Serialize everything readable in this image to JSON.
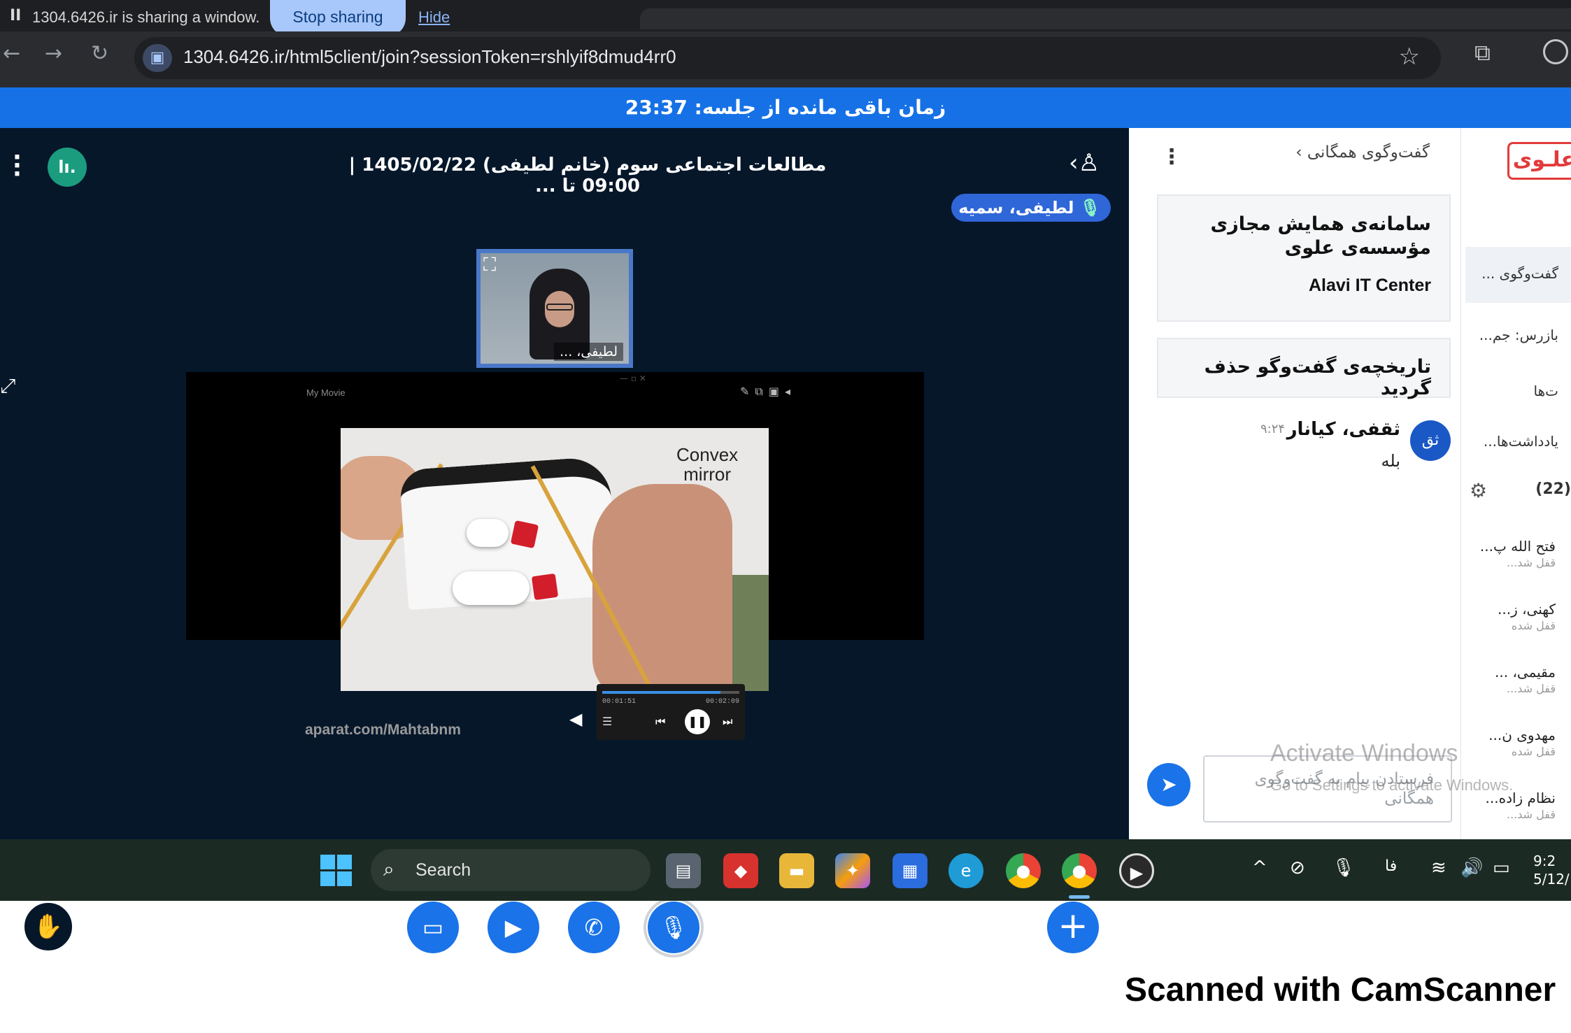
{
  "browser": {
    "share_notice": "1304.6426.ir is sharing a window.",
    "stop_sharing_label": "Stop sharing",
    "hide_label": "Hide",
    "url": "1304.6426.ir/html5client/join?sessionToken=rshlyif8dmud4rr0"
  },
  "session": {
    "timer_text": "زمان باقی مانده از جلسه: 23:37",
    "meeting_title": "مطالعات اجتماعی سوم (خانم لطیفی) 1405/02/22 | 09:00 تا ...",
    "talker_name": "لطیفی، سمیه",
    "camera_name": "لطیفی، ..."
  },
  "screenshare": {
    "window_title": "My Movie",
    "video_label_line1": "Convex",
    "video_label_line2": "mirror",
    "watermark": "aparat.com/Mahtabnm",
    "time_elapsed": "00:01:51",
    "time_total": "00:02:09",
    "progress_fraction": 0.86
  },
  "chat": {
    "title": "گفت‌وگوی همگانی",
    "welcome_line": "سامانه‌ی همایش مجازی مؤسسه‌ی علوی",
    "welcome_brand": "Alavi IT Center",
    "cleared_notice": "تاریخچه‌ی گفت‌وگو حذف گردید",
    "messages": [
      {
        "avatar": "ثق",
        "name": "ثقفی، کیانار",
        "time": "۹:۲۴",
        "text": "بله"
      }
    ],
    "input_placeholder": "فرستادن پیام به گفت‌وگوی همگانی"
  },
  "sidebar": {
    "brand": "علـوی",
    "items": [
      "گفت‌وگوی ...",
      "بازرس: جم...",
      "ت‌ها",
      "یادداشت‌ها..."
    ],
    "users_count": "(22)",
    "users": [
      {
        "name": "فتح الله پ...",
        "status": "قفل شد..."
      },
      {
        "name": "کهنی، ز...",
        "status": "قفل شده"
      },
      {
        "name": "مقیمی، ...",
        "status": "قفل شد..."
      },
      {
        "name": "مهدوی ن...",
        "status": "قفل شده"
      },
      {
        "name": "نظام زاده...",
        "status": "قفل شد..."
      }
    ]
  },
  "windows_overlay": {
    "activate_title": "Activate Windows",
    "activate_sub": "Go to Settings to activate Windows."
  },
  "taskbar": {
    "search_label": "Search",
    "lang": "فا",
    "clock_time": "9:2",
    "clock_date": "5/12/"
  },
  "footer": {
    "scan_text": "Scanned with CamScanner"
  },
  "colors": {
    "accent": "#1a73e8",
    "timer_bar": "#1671e6",
    "meeting_bg": "#06172a",
    "brand_red": "#e23a3a"
  }
}
